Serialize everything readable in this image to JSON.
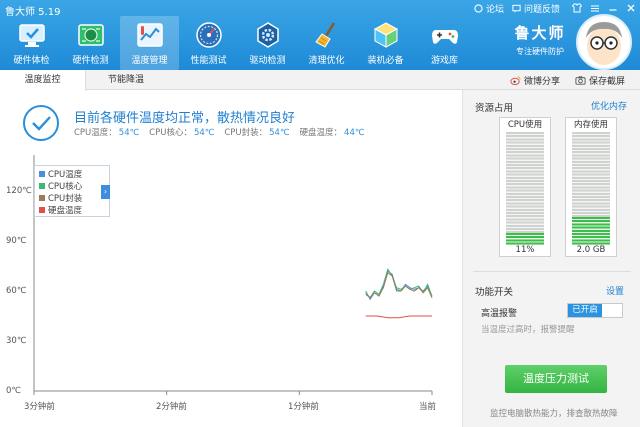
{
  "app": {
    "title": "鲁大师 5.19"
  },
  "top_links": {
    "forum": "论坛",
    "feedback": "问题反馈"
  },
  "toolbar": {
    "items": [
      {
        "label": "硬件体检",
        "icon": "monitor-check-icon"
      },
      {
        "label": "硬件检测",
        "icon": "circuit-board-icon"
      },
      {
        "label": "温度管理",
        "icon": "thermometer-chart-icon",
        "active": true
      },
      {
        "label": "性能测试",
        "icon": "speedometer-icon"
      },
      {
        "label": "驱动检测",
        "icon": "gear-chip-icon"
      },
      {
        "label": "清理优化",
        "icon": "broom-icon"
      },
      {
        "label": "装机必备",
        "icon": "package-box-icon"
      },
      {
        "label": "游戏库",
        "icon": "gamepad-icon"
      }
    ]
  },
  "brand": {
    "name": "鲁大师",
    "slogan": "专注硬件防护"
  },
  "tabs": {
    "monitor": "温度监控",
    "cooling": "节能降温"
  },
  "actions": {
    "share": "微博分享",
    "screenshot": "保存截屏"
  },
  "status": {
    "title": "目前各硬件温度均正常，散热情况良好",
    "readings": [
      {
        "label": "CPU温度：",
        "value": "54℃"
      },
      {
        "label": "CPU核心：",
        "value": "54℃"
      },
      {
        "label": "CPU封装：",
        "value": "54℃"
      },
      {
        "label": "硬盘温度：",
        "value": "44℃"
      }
    ]
  },
  "chart_data": {
    "type": "line",
    "y_ticks": [
      "120℃",
      "90℃",
      "60℃",
      "30℃",
      "0℃"
    ],
    "ylim": [
      0,
      120
    ],
    "x_ticks": [
      "3分钟前",
      "2分钟前",
      "1分钟前",
      "当前"
    ],
    "xlim": [
      0,
      180
    ],
    "legend_position": "top-left",
    "grid": false,
    "series": [
      {
        "name": "CPU温度",
        "color": "#4a8fd8",
        "x": [
          150,
          152,
          154,
          156,
          158,
          160,
          162,
          164,
          166,
          168,
          170,
          172,
          174,
          176,
          178,
          180
        ],
        "y": [
          60,
          55,
          59,
          57,
          63,
          72,
          70,
          61,
          60,
          64,
          62,
          61,
          62,
          60,
          63,
          56
        ]
      },
      {
        "name": "CPU核心",
        "color": "#3cb878",
        "x": [
          150,
          152,
          154,
          156,
          158,
          160,
          162,
          164,
          166,
          168,
          170,
          172,
          174,
          176,
          178,
          180
        ],
        "y": [
          59,
          56,
          60,
          58,
          64,
          73,
          69,
          62,
          61,
          63,
          61,
          62,
          63,
          59,
          64,
          57
        ]
      },
      {
        "name": "CPU封装",
        "color": "#a0785a",
        "x": [
          150,
          152,
          154,
          156,
          158,
          160,
          162,
          164,
          166,
          168,
          170,
          172,
          174,
          176,
          178,
          180
        ],
        "y": [
          58,
          56,
          59,
          57,
          62,
          71,
          69,
          60,
          60,
          63,
          61,
          60,
          62,
          59,
          62,
          56
        ]
      },
      {
        "name": "硬盘温度",
        "color": "#e0504a",
        "x": [
          150,
          155,
          160,
          165,
          170,
          175,
          180
        ],
        "y": [
          45,
          45,
          44,
          44,
          45,
          45,
          45
        ]
      }
    ]
  },
  "resources": {
    "title": "资源占用",
    "optimize_link": "优化内存",
    "cpu": {
      "label": "CPU使用",
      "value": "11%",
      "fill": 0.11
    },
    "memory": {
      "label": "内存使用",
      "value": "2.0 GB",
      "fill": 0.25
    }
  },
  "features": {
    "title": "功能开关",
    "settings_link": "设置",
    "high_temp_alert": {
      "label": "高温报警",
      "state": "已开启",
      "desc": "当温度过高时，报警提醒"
    },
    "stress_test": {
      "label": "温度压力测试",
      "desc": "监控电脑散热能力，排查散热故障"
    }
  },
  "colors": {
    "header": "#2596de",
    "accent": "#1f7fd0",
    "green": "#3cbf4a"
  }
}
